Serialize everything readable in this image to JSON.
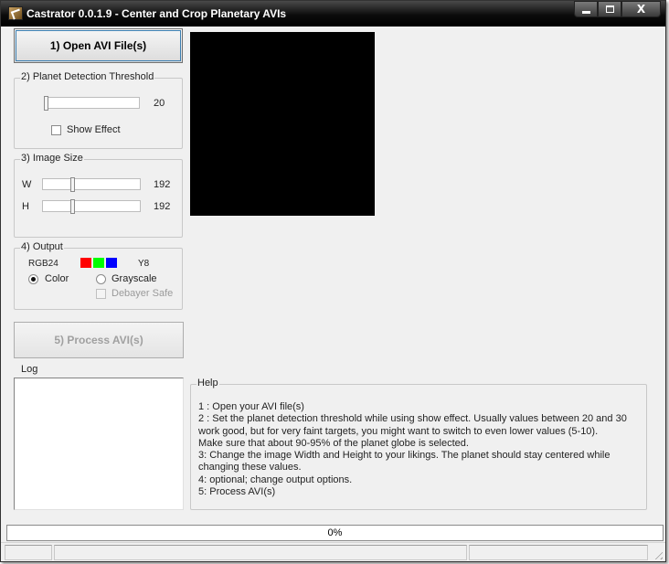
{
  "window": {
    "title": "Castrator 0.0.1.9 - Center and Crop Planetary AVIs",
    "close_glyph": "X"
  },
  "buttons": {
    "open_label": "1) Open AVI File(s)",
    "process_label": "5) Process AVI(s)"
  },
  "threshold": {
    "legend": "2) Planet Detection Threshold",
    "value": "20",
    "show_effect_label": "Show Effect",
    "show_effect_checked": false
  },
  "image_size": {
    "legend": "3) Image Size",
    "w_label": "W",
    "w_value": "192",
    "h_label": "H",
    "h_value": "192"
  },
  "output": {
    "legend": "4) Output",
    "rgb_label": "RGB24",
    "y8_label": "Y8",
    "color_label": "Color",
    "grayscale_label": "Grayscale",
    "debayer_label": "Debayer Safe",
    "selected": "Color",
    "swatch_colors": [
      "#ff0000",
      "#00ff00",
      "#0000ff"
    ]
  },
  "log": {
    "legend": "Log",
    "content": ""
  },
  "help": {
    "legend": "Help",
    "lines": [
      "1 : Open your AVI file(s)",
      "2 : Set the planet detection threshold while using show effect. Usually values between 20 and 30",
      "     work good, but for very faint targets, you might want to switch to even lower values (5-10).",
      "     Make sure that about 90-95% of the planet globe is selected.",
      "3: Change the image Width and Height to your likings. The planet should stay centered while",
      "     changing these values.",
      "4: optional; change output options.",
      "5: Process AVI(s)"
    ]
  },
  "progress": {
    "label": "0%",
    "fraction": 0
  }
}
